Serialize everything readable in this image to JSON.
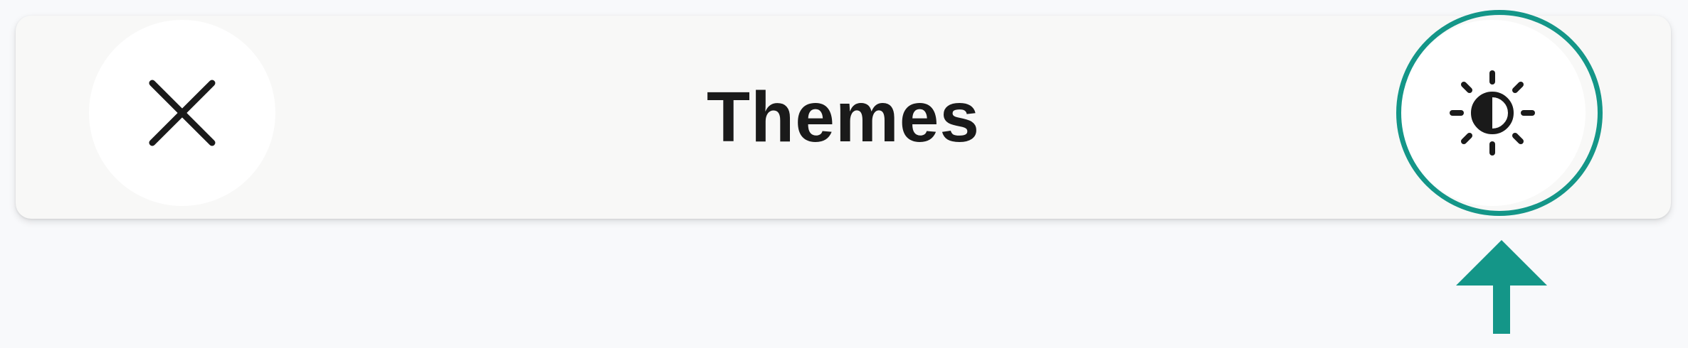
{
  "header": {
    "title": "Themes"
  },
  "icons": {
    "close": "close-icon",
    "theme": "contrast-brightness-icon",
    "arrow": "arrow-up-icon"
  },
  "colors": {
    "highlight": "#149688",
    "icon": "#1a1a1a",
    "bar_background": "#f8f8f7",
    "page_background": "#f8f9fb"
  }
}
